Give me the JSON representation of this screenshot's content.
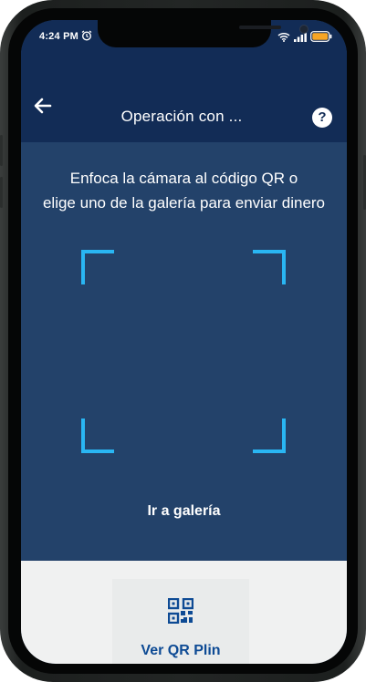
{
  "status": {
    "time": "4:24 PM"
  },
  "header": {
    "title": "Operación con ...",
    "help_label": "?"
  },
  "instructions": {
    "line1": "Enfoca la cámara al código QR o",
    "line2": "elige uno de la galería para enviar dinero"
  },
  "gallery_label": "Ir a galería",
  "bottom": {
    "qr_button_label": "Ver QR Plin"
  },
  "colors": {
    "header": "#122c56",
    "background": "#23426a",
    "scanner_corner": "#29b6f3",
    "qr_accent": "#0d4a94"
  },
  "icons": [
    "alarm-icon",
    "wifi-icon",
    "signal-icon",
    "battery-icon",
    "back-arrow-icon",
    "help-icon",
    "qr-code-icon"
  ]
}
